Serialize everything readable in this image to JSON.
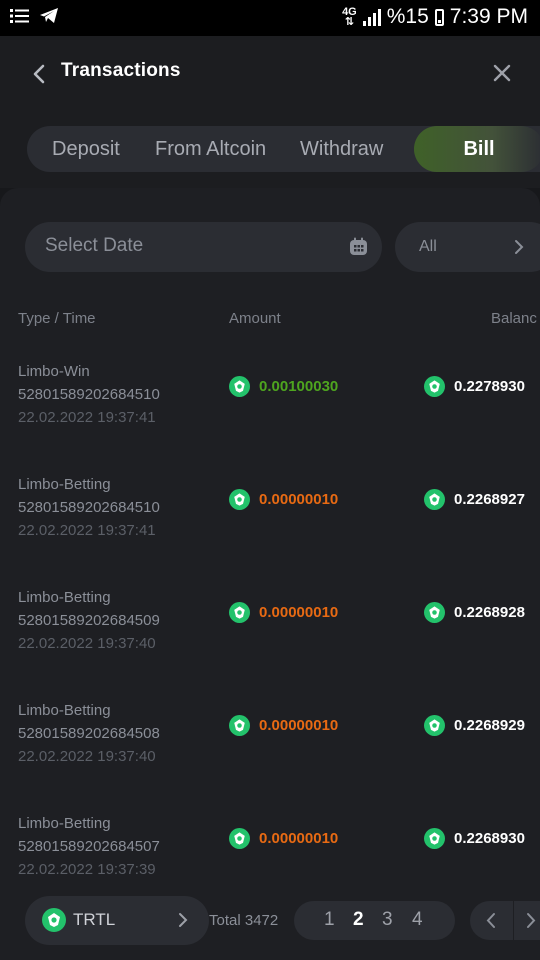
{
  "status_bar": {
    "network_top": "4G",
    "battery": "%15",
    "time": "7:39 PM"
  },
  "header": {
    "title": "Transactions"
  },
  "tabs": [
    {
      "label": "Deposit"
    },
    {
      "label": "From Altcoin"
    },
    {
      "label": "Withdraw"
    },
    {
      "label": "Bill",
      "active": true
    }
  ],
  "filters": {
    "date_placeholder": "Select Date",
    "type_value": "All"
  },
  "columns": {
    "type_time": "Type / Time",
    "amount": "Amount",
    "balance": "Balanc"
  },
  "colors": {
    "win": "#4ea51f",
    "bet": "#e86a13",
    "accent": "#3f6128",
    "coin": "#23c26b"
  },
  "transactions": [
    {
      "type": "Limbo-Win",
      "id": "52801589202684510",
      "time": "22.02.2022 19:37:41",
      "amount": "0.00100030",
      "amount_kind": "win",
      "balance": "0.2278930"
    },
    {
      "type": "Limbo-Betting",
      "id": "52801589202684510",
      "time": "22.02.2022 19:37:41",
      "amount": "0.00000010",
      "amount_kind": "bet",
      "balance": "0.2268927"
    },
    {
      "type": "Limbo-Betting",
      "id": "52801589202684509",
      "time": "22.02.2022 19:37:40",
      "amount": "0.00000010",
      "amount_kind": "bet",
      "balance": "0.2268928"
    },
    {
      "type": "Limbo-Betting",
      "id": "52801589202684508",
      "time": "22.02.2022 19:37:40",
      "amount": "0.00000010",
      "amount_kind": "bet",
      "balance": "0.2268929"
    },
    {
      "type": "Limbo-Betting",
      "id": "52801589202684507",
      "time": "22.02.2022 19:37:39",
      "amount": "0.00000010",
      "amount_kind": "bet",
      "balance": "0.2268930"
    }
  ],
  "footer": {
    "currency": "TRTL",
    "total": "Total 3472",
    "pages": [
      "1",
      "2",
      "3",
      "4"
    ],
    "current_page": "2"
  }
}
